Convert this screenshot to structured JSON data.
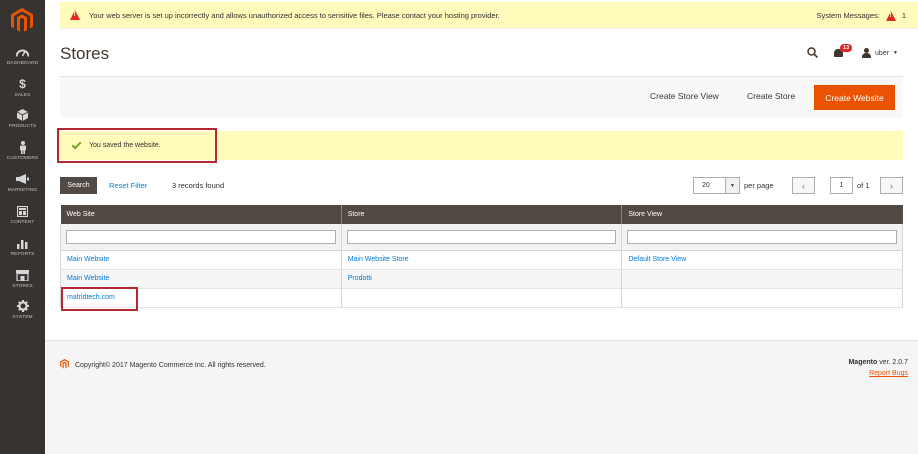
{
  "sidebar": {
    "items": [
      {
        "label": "DASHBOARD",
        "icon": "dashboard-icon"
      },
      {
        "label": "SALES",
        "icon": "dollar-icon"
      },
      {
        "label": "PRODUCTS",
        "icon": "cube-icon"
      },
      {
        "label": "CUSTOMERS",
        "icon": "person-icon"
      },
      {
        "label": "MARKETING",
        "icon": "megaphone-icon"
      },
      {
        "label": "CONTENT",
        "icon": "layout-icon"
      },
      {
        "label": "REPORTS",
        "icon": "bar-chart-icon"
      },
      {
        "label": "STORES",
        "icon": "store-icon"
      },
      {
        "label": "SYSTEM",
        "icon": "gear-icon"
      }
    ]
  },
  "system_message": {
    "text": "Your web server is set up incorrectly and allows unauthorized access to sensitive files. Please contact your hosting provider.",
    "label": "System Messages:",
    "count": "1"
  },
  "header": {
    "title": "Stores",
    "notifications_count": "13",
    "username": "uber"
  },
  "actions": {
    "create_store_view": "Create Store View",
    "create_store": "Create Store",
    "create_website": "Create Website"
  },
  "success": {
    "text": "You saved the website."
  },
  "grid_toolbar": {
    "search_label": "Search",
    "reset_label": "Reset Filter",
    "records": "3 records found",
    "per_page_value": "20",
    "per_page_label": "per page",
    "page_value": "1",
    "of_pages": "of 1"
  },
  "table": {
    "columns": [
      "Web Site",
      "Store",
      "Store View"
    ],
    "rows": [
      [
        "Main Website",
        "Main Website Store",
        "Default Store View"
      ],
      [
        "Main Website",
        "Prodotti",
        ""
      ],
      [
        "matridtech.com",
        "",
        ""
      ]
    ]
  },
  "footer": {
    "copyright": "Copyright© 2017 Magento Commerce Inc. All rights reserved.",
    "brand": "Magento",
    "version": " ver. 2.0.7",
    "report_bugs": "Report Bugs"
  },
  "colors": {
    "accent": "#eb5202",
    "sidebar": "#373330",
    "link": "#007bdb",
    "highlight_box": "#b3292f"
  }
}
